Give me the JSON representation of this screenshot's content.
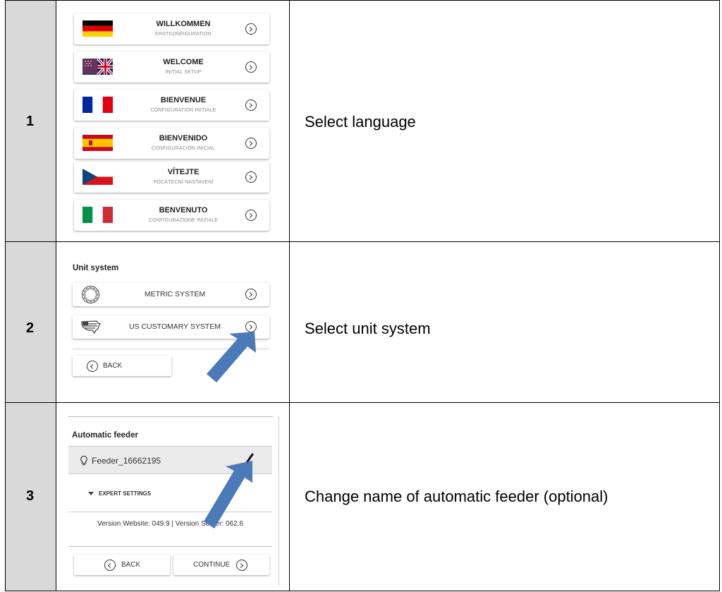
{
  "rows": [
    {
      "number": "1",
      "description": "Select language",
      "languages": [
        {
          "title": "WILLKOMMEN",
          "subtitle": "ERSTKONFIGURATION",
          "flag_icon": "germany-flag-icon"
        },
        {
          "title": "WELCOME",
          "subtitle": "INITIAL SETUP",
          "flag_icon": "uk-flag-icon"
        },
        {
          "title": "BIENVENUE",
          "subtitle": "CONFIGURATION INITIALE",
          "flag_icon": "france-flag-icon"
        },
        {
          "title": "BIENVENIDO",
          "subtitle": "CONFIGURACIÓN INICIAL",
          "flag_icon": "spain-flag-icon"
        },
        {
          "title": "VÍTEJTE",
          "subtitle": "POCÁTECNÍ NASTAVENÍ",
          "flag_icon": "czech-flag-icon"
        },
        {
          "title": "BENVENUTO",
          "subtitle": "CONFIGURAZIONE INIZIALE",
          "flag_icon": "italy-flag-icon"
        }
      ]
    },
    {
      "number": "2",
      "description": "Select unit system",
      "section_title": "Unit system",
      "options": [
        {
          "label": "METRIC SYSTEM",
          "icon": "eu-stars-icon"
        },
        {
          "label": "US CUSTOMARY SYSTEM",
          "icon": "us-map-icon"
        }
      ],
      "back_label": "BACK"
    },
    {
      "number": "3",
      "description": "Change name of automatic feeder (optional)",
      "section_title": "Automatic feeder",
      "feeder_name": "Feeder_16662195",
      "expert_settings": "EXPERT SETTINGS",
      "version_text": "Version Website: 049.9 | Version Server: 062.6",
      "back_label": "BACK",
      "continue_label": "CONTINUE"
    }
  ],
  "colors": {
    "number_column": "#d9d9d9",
    "arrow": "#4a7ab7"
  }
}
